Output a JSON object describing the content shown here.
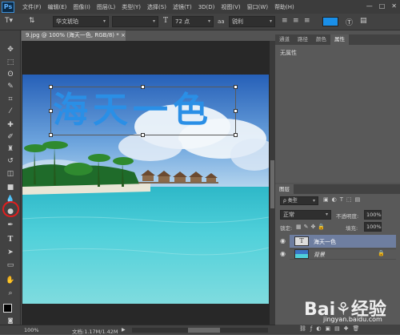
{
  "app": {
    "logo": "Ps"
  },
  "menu": [
    "文件(F)",
    "编辑(E)",
    "图像(I)",
    "图层(L)",
    "类型(Y)",
    "选择(S)",
    "滤镜(T)",
    "3D(D)",
    "视图(V)",
    "窗口(W)",
    "帮助(H)"
  ],
  "window_controls": [
    "—",
    "□",
    "✕"
  ],
  "options": {
    "font_family": "华文琥珀",
    "font_size": "72 点",
    "antialias_label": "aa",
    "antialias": "锐利",
    "text_color": "#1a8fe8"
  },
  "document": {
    "tab": "9.jpg @ 100% (海天一色, RGB/8) * ",
    "tab_close": "×",
    "canvas_text": "海天一色",
    "sky_color": "#2f6ec2",
    "sea_color": "#47c6d6"
  },
  "status": {
    "zoom": "100%",
    "doc_info": "文档:1.17M/1.42M"
  },
  "panels": {
    "top_tabs": [
      "通道",
      "路径",
      "颜色",
      "属性"
    ],
    "active_top_tab": "属性",
    "no_properties": "无属性",
    "layers_tab": "图层",
    "kind_filter": "ρ 类型",
    "blend_mode": "正常",
    "opacity_label": "不透明度:",
    "opacity": "100%",
    "lock_label": "锁定:",
    "fill_label": "填充:",
    "fill": "100%",
    "layers": [
      {
        "name": "海天一色",
        "type": "text",
        "thumb": "T",
        "selected": true
      },
      {
        "name": "背景",
        "type": "image",
        "locked": true,
        "selected": false
      }
    ]
  },
  "watermark": {
    "text": "Bai⚘经验",
    "url": "jingyan.baidu.com"
  }
}
